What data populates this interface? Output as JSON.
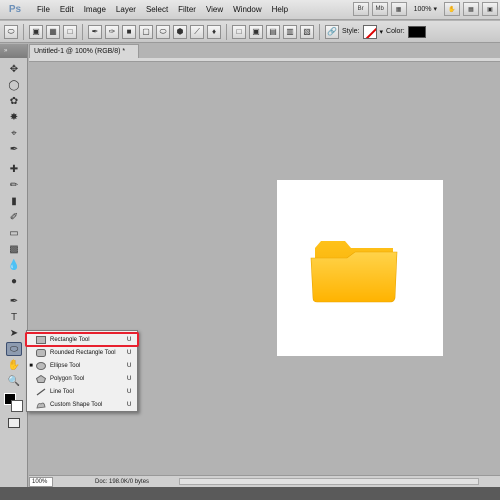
{
  "app": {
    "logo": "Ps",
    "menu": [
      "File",
      "Edit",
      "Image",
      "Layer",
      "Select",
      "Filter",
      "View",
      "Window",
      "Help"
    ],
    "zoom_level": "100%",
    "right_buttons": [
      "Br",
      "Mb"
    ]
  },
  "options": {
    "style_label": "Style:",
    "color_label": "Color:",
    "color_value": "#000000"
  },
  "document": {
    "tab_title": "Untitled-1 @ 100% (RGB/8) *",
    "status_zoom": "100%",
    "status_info": "Doc: 198.0K/0 bytes"
  },
  "toolbar": {
    "header": "»"
  },
  "flyout": {
    "items": [
      {
        "label": "Rectangle Tool",
        "key": "U",
        "active": false,
        "icon": "rectangle-icon"
      },
      {
        "label": "Rounded Rectangle Tool",
        "key": "U",
        "active": false,
        "icon": "rounded-rectangle-icon"
      },
      {
        "label": "Ellipse Tool",
        "key": "U",
        "active": true,
        "icon": "ellipse-icon"
      },
      {
        "label": "Polygon Tool",
        "key": "U",
        "active": false,
        "icon": "polygon-icon"
      },
      {
        "label": "Line Tool",
        "key": "U",
        "active": false,
        "icon": "line-icon"
      },
      {
        "label": "Custom Shape Tool",
        "key": "U",
        "active": false,
        "icon": "custom-shape-icon"
      }
    ],
    "highlight_color": "#e8202e"
  },
  "colors": {
    "folder_dark": "#f5b400",
    "folder_light": "#ffd24a"
  }
}
